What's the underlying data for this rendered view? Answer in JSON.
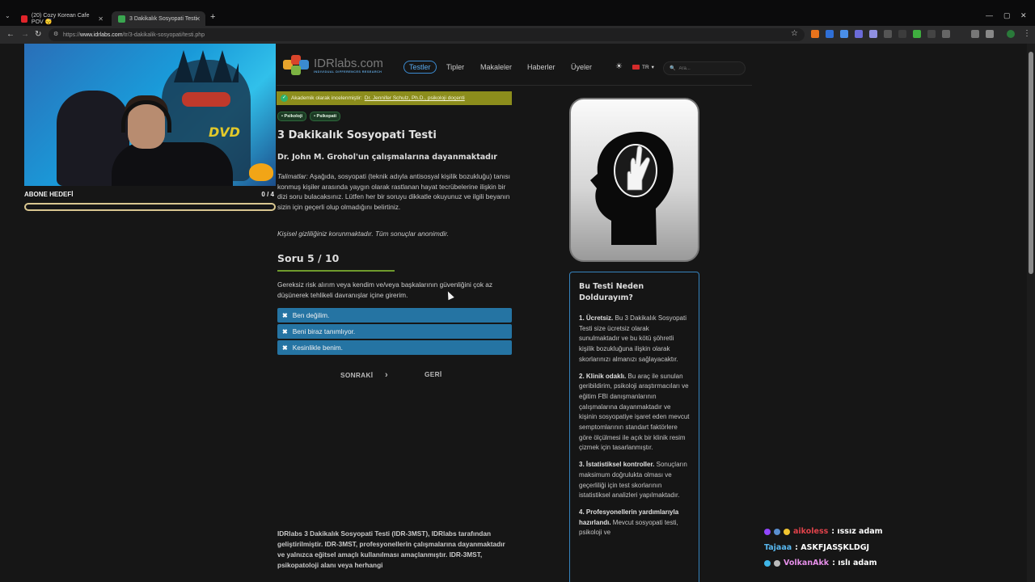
{
  "browser": {
    "tabs": [
      {
        "title": "(20) Cozy Korean Cafe POV 😴",
        "active": false,
        "favicon_color": "#e0242a"
      },
      {
        "title": "3 Dakikalık Sosyopati Testi",
        "active": true,
        "favicon_color": "#3aa650"
      }
    ],
    "url_prefix": "https://",
    "url_host": "www.idrlabs.com",
    "url_path": "/tr/3-dakikalik-sosyopati/testi.php",
    "new_tab": "+",
    "tab_menu": "⌄",
    "nav": {
      "back": "←",
      "forward": "→",
      "reload": "↻",
      "site_info": "⚙",
      "bookmark": "☆",
      "menu": "⋮"
    },
    "window_controls": {
      "minimize": "—",
      "maximize": "▢",
      "close": "✕"
    }
  },
  "stream_overlay": {
    "sub_goal_label": "ABONE HEDEFİ",
    "sub_goal_count": "0 / 4",
    "sub_goal_progress": 0,
    "webcam_text": "DVD"
  },
  "site": {
    "logo_name": "IDRlabs.com",
    "logo_sub": "INDIVIDUAL DIFFERENCES RESEARCH",
    "menu": [
      "Testler",
      "Tipler",
      "Makaleler",
      "Haberler",
      "Üyeler"
    ],
    "active_menu": "Testler",
    "language": "TR",
    "language_caret": "▾",
    "theme_icon": "☀",
    "search_icon": "🔍",
    "search_placeholder": "Ara..."
  },
  "test": {
    "reviewed_prefix": "Akademik olarak incelenmiştir:",
    "reviewed_link": "Dr. Jennifer Schulz, Ph.D., psikoloji doçenti",
    "check": "✓",
    "tags": [
      "• Psikoloji",
      "• Psikopati"
    ],
    "title": "3 Dakikalık Sosyopati Testi",
    "subtitle": "Dr. John M. Grohol'un çalışmalarına dayanmaktadır",
    "instructions_label": "Talimatlar:",
    "instructions": "Aşağıda, sosyopati (teknik adıyla antisosyal kişilik bozukluğu) tanısı konmuş kişiler arasında yaygın olarak rastlanan hayat tecrübelerine ilişkin bir dizi soru bulacaksınız. Lütfen her bir soruyu dikkatle okuyunuz ve ilgili beyanın sizin için geçerli olup olmadığını belirtiniz.",
    "privacy": "Kişisel gizliliğiniz korunmaktadır. Tüm sonuçlar anonimdir.",
    "question_counter": "Soru 5 / 10",
    "progress": 0.5,
    "question": "Gereksiz risk alırım veya kendim ve/veya başkalarının güvenliğini çok az düşünerek tehlikeli davranışlar içine girerim.",
    "answer_icon": "✖",
    "answers": [
      "Ben değilim.",
      "Beni biraz tanımlıyor.",
      "Kesinlikle benim."
    ],
    "next_label": "SONRAKİ",
    "next_icon": "›",
    "back_label": "GERİ",
    "bottom_text": "IDRlabs 3 Dakikalık Sosyopati Testi (IDR-3MST), IDRlabs tarafından geliştirilmiştir. IDR-3MST, profesyonellerin çalışmalarına dayanmaktadır ve yalnızca eğitsel amaçlı kullanılması amaçlanmıştır. IDR-3MST, psikopatoloji alanı veya herhangi"
  },
  "sidebar": {
    "heading": "Bu Testi Neden Doldurayım?",
    "items": [
      {
        "title": "1. Ücretsiz.",
        "text": "Bu 3 Dakikalık Sosyopati Testi size ücretsiz olarak sunulmaktadır ve bu kötü şöhretli kişilik bozukluğuna ilişkin olarak skorlarınızı almanızı sağlayacaktır."
      },
      {
        "title": "2. Klinik odaklı.",
        "text": "Bu araç ile sunulan geribildirim, psikoloji araştırmacıları ve eğitim FBI danışmanlarının çalışmalarına dayanmaktadır ve kişinin sosyopatiye işaret eden mevcut semptomlarının standart faktörlere göre ölçülmesi ile açık bir klinik resim çizmek için tasarlanmıştır."
      },
      {
        "title": "3. İstatistiksel kontroller.",
        "text": "Sonuçların maksimum doğrulukta olması ve geçerliliği için test skorlarının istatistiksel analizleri yapılmaktadır."
      },
      {
        "title": "4. Profesyonellerin yardımlarıyla hazırlandı.",
        "text": "Mevcut sosyopati testi, psikoloji ve"
      }
    ]
  },
  "chat": [
    {
      "user": "aikoless",
      "message": ": ıssız adam",
      "color": "#e0424a"
    },
    {
      "user": "Tajaaa",
      "message": ": ASKFJASŞKLDGJ",
      "color": "#58b8f0"
    },
    {
      "user": "VolkanAkk",
      "message": ": ıslı adam",
      "color": "#e58ee8"
    }
  ]
}
